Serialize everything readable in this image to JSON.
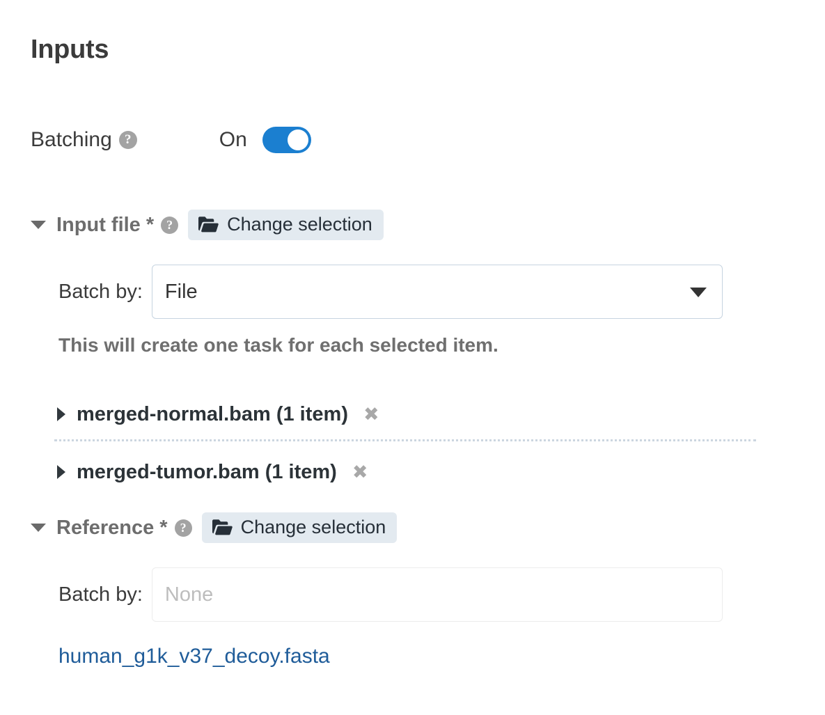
{
  "page": {
    "title": "Inputs"
  },
  "batching": {
    "label": "Batching",
    "help_icon": "help-circle-icon",
    "state_label": "On",
    "enabled": true,
    "toggle_color": "#1b7fd0"
  },
  "sections": [
    {
      "id": "input-file",
      "label": "Input file *",
      "expanded": true,
      "help_icon": "help-circle-icon",
      "change_button": {
        "label": "Change selection",
        "icon": "open-folder-icon"
      },
      "batch_by": {
        "label": "Batch by:",
        "value": "File",
        "placeholder": "",
        "disabled": false,
        "options": [
          "File"
        ]
      },
      "helper_text": "This will create one task for each selected item.",
      "files": [
        {
          "name": "merged-normal.bam (1 item)",
          "expanded": false,
          "remove_icon": "✖"
        },
        {
          "name": "merged-tumor.bam (1 item)",
          "expanded": false,
          "remove_icon": "✖"
        }
      ]
    },
    {
      "id": "reference",
      "label": "Reference *",
      "expanded": true,
      "help_icon": "help-circle-icon",
      "change_button": {
        "label": "Change selection",
        "icon": "open-folder-icon"
      },
      "batch_by": {
        "label": "Batch by:",
        "value": "",
        "placeholder": "None",
        "disabled": true,
        "options": []
      },
      "link": "human_g1k_v37_decoy.fasta"
    }
  ],
  "colors": {
    "accent_blue": "#1b7fd0",
    "link_blue": "#1f5c99",
    "button_bg": "#e3eaf0",
    "label_grey": "#6d6d6d",
    "divider": "#ccd6e0"
  },
  "glyphs": {
    "help": "?",
    "remove": "✖"
  }
}
